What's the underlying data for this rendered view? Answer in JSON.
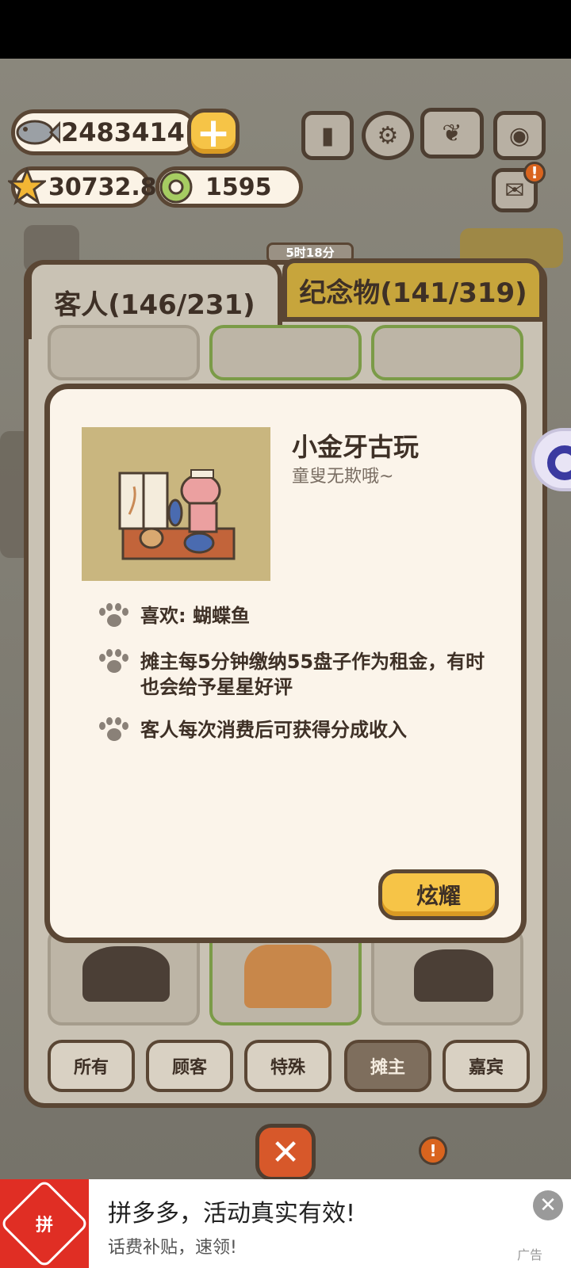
{
  "currency": {
    "fish": "2483414",
    "stars": "30732.8",
    "coins": "1595"
  },
  "top_icons": [
    "ranking-icon",
    "settings-gear-icon",
    "paw-book-icon",
    "camera-icon",
    "mail-icon"
  ],
  "timer": "5时18分",
  "tabs": {
    "guests": "客人(146/231)",
    "souvenirs": "纪念物(141/319)"
  },
  "detail": {
    "name": "小金牙古玩",
    "subtitle": "童叟无欺哦~",
    "traits": [
      "喜欢: 蝴蝶鱼",
      "摊主每5分钟缴纳55盘子作为租金，有时也会给予星星好评",
      "客人每次消费后可获得分成收入"
    ],
    "show_button": "炫耀"
  },
  "filters": {
    "all": "所有",
    "customer": "顾客",
    "special": "特殊",
    "stall_owner": "摊主",
    "guest": "嘉宾"
  },
  "ad": {
    "title": "拼多多，活动真实有效!",
    "subtitle": "话费补贴，速领!",
    "tag": "广告",
    "logo_text": "拼"
  }
}
